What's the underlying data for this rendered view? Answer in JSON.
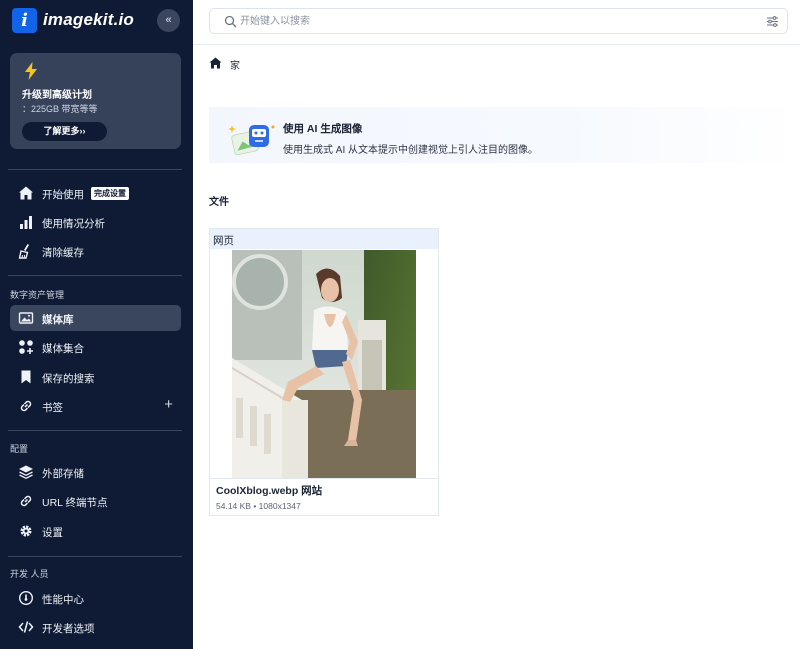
{
  "brand": {
    "logo_letter": "i",
    "name": "imagekit.io"
  },
  "sidebar": {
    "collapse_glyph": "«",
    "upgrade": {
      "title": "升级到高级计划",
      "subtitle": "：225GB 带宽等等",
      "button_label": "了解更多››"
    },
    "getting_started": {
      "label": "开始使用",
      "badge": "完成设置"
    },
    "usage": {
      "label": "使用情况分析"
    },
    "cache": {
      "label": "清除缓存"
    },
    "dam_section": "数字资产管理",
    "media_library": {
      "label": "媒体库"
    },
    "media_collections": {
      "label": "媒体集合"
    },
    "saved_searches": {
      "label": "保存的搜索"
    },
    "bookmarks": {
      "label": "书签",
      "add_glyph": "+"
    },
    "config_section": "配置",
    "external_storage": {
      "label": "外部存储"
    },
    "url_endpoints": {
      "label": "URL 终端节点"
    },
    "settings": {
      "label": "设置"
    },
    "dev_section": "开发 人员",
    "performance": {
      "label": "性能中心"
    },
    "developer_options": {
      "label": "开发者选项"
    }
  },
  "search": {
    "placeholder": "开始键入以搜索",
    "value": ""
  },
  "breadcrumb": {
    "home": "家"
  },
  "ai_banner": {
    "title": "使用 AI 生成图像",
    "description": "使用生成式 AI 从文本提示中创建视觉上引人注目的图像。"
  },
  "files_heading": "文件",
  "file_card": {
    "tag": "网页",
    "name": "CoolXblog.webp 网站",
    "meta": "54.14 KB • 1080x1347"
  },
  "colors": {
    "sidebar_bg": "#0f1b34",
    "accent": "#1363e9",
    "active_item": "#3a465e",
    "banner_bg": "#f3f7fd",
    "file_tag_bg": "#e9f1fc"
  }
}
